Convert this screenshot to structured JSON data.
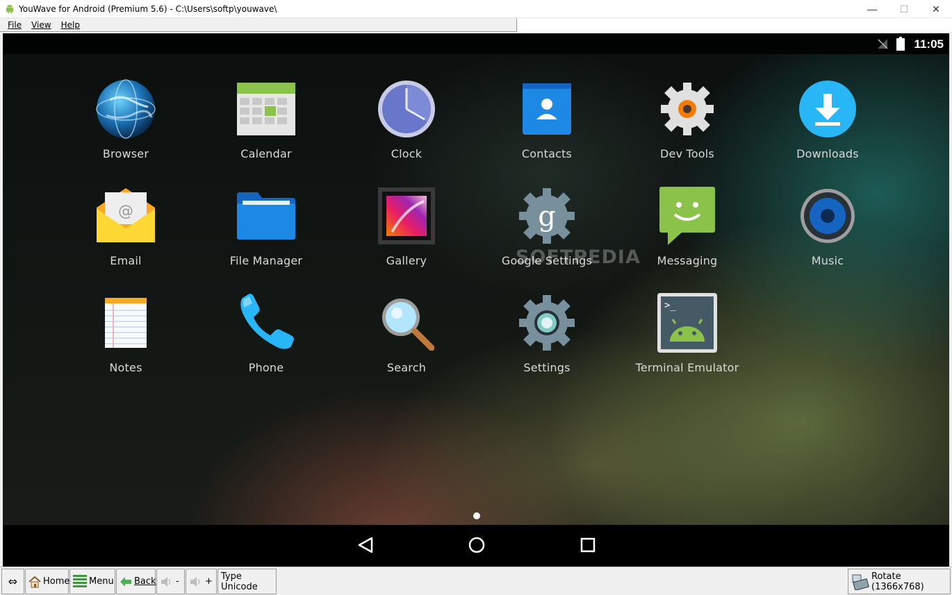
{
  "window": {
    "title": "YouWave for Android (Premium 5.6) - C:\\Users\\softp\\youwave\\",
    "minimize": "—",
    "maximize": "☐",
    "close": "✕"
  },
  "menu": [
    {
      "label": "File"
    },
    {
      "label": "View"
    },
    {
      "label": "Help"
    }
  ],
  "status": {
    "time": "11:05"
  },
  "apps": [
    {
      "label": "Browser",
      "icon": "browser-globe-icon"
    },
    {
      "label": "Calendar",
      "icon": "calendar-icon"
    },
    {
      "label": "Clock",
      "icon": "clock-icon"
    },
    {
      "label": "Contacts",
      "icon": "contacts-icon"
    },
    {
      "label": "Dev Tools",
      "icon": "dev-tools-gear-icon"
    },
    {
      "label": "Downloads",
      "icon": "download-icon"
    },
    {
      "label": "Email",
      "icon": "email-envelope-icon"
    },
    {
      "label": "File Manager",
      "icon": "folder-icon"
    },
    {
      "label": "Gallery",
      "icon": "gallery-icon"
    },
    {
      "label": "Google Settings",
      "icon": "google-settings-icon"
    },
    {
      "label": "Messaging",
      "icon": "messaging-icon"
    },
    {
      "label": "Music",
      "icon": "music-speaker-icon"
    },
    {
      "label": "Notes",
      "icon": "notes-icon"
    },
    {
      "label": "Phone",
      "icon": "phone-icon"
    },
    {
      "label": "Search",
      "icon": "magnifier-icon"
    },
    {
      "label": "Settings",
      "icon": "settings-gear-icon"
    },
    {
      "label": "Terminal Emulator",
      "icon": "terminal-android-icon"
    }
  ],
  "watermark": "SOFTPEDIA",
  "toolbar": {
    "resize_icon": "⇔",
    "home": "Home",
    "menu": "Menu",
    "back": "Back",
    "vol_down": "-",
    "vol_up": "+",
    "type_unicode": "Type Unicode",
    "rotate": "Rotate (1366x768)"
  }
}
